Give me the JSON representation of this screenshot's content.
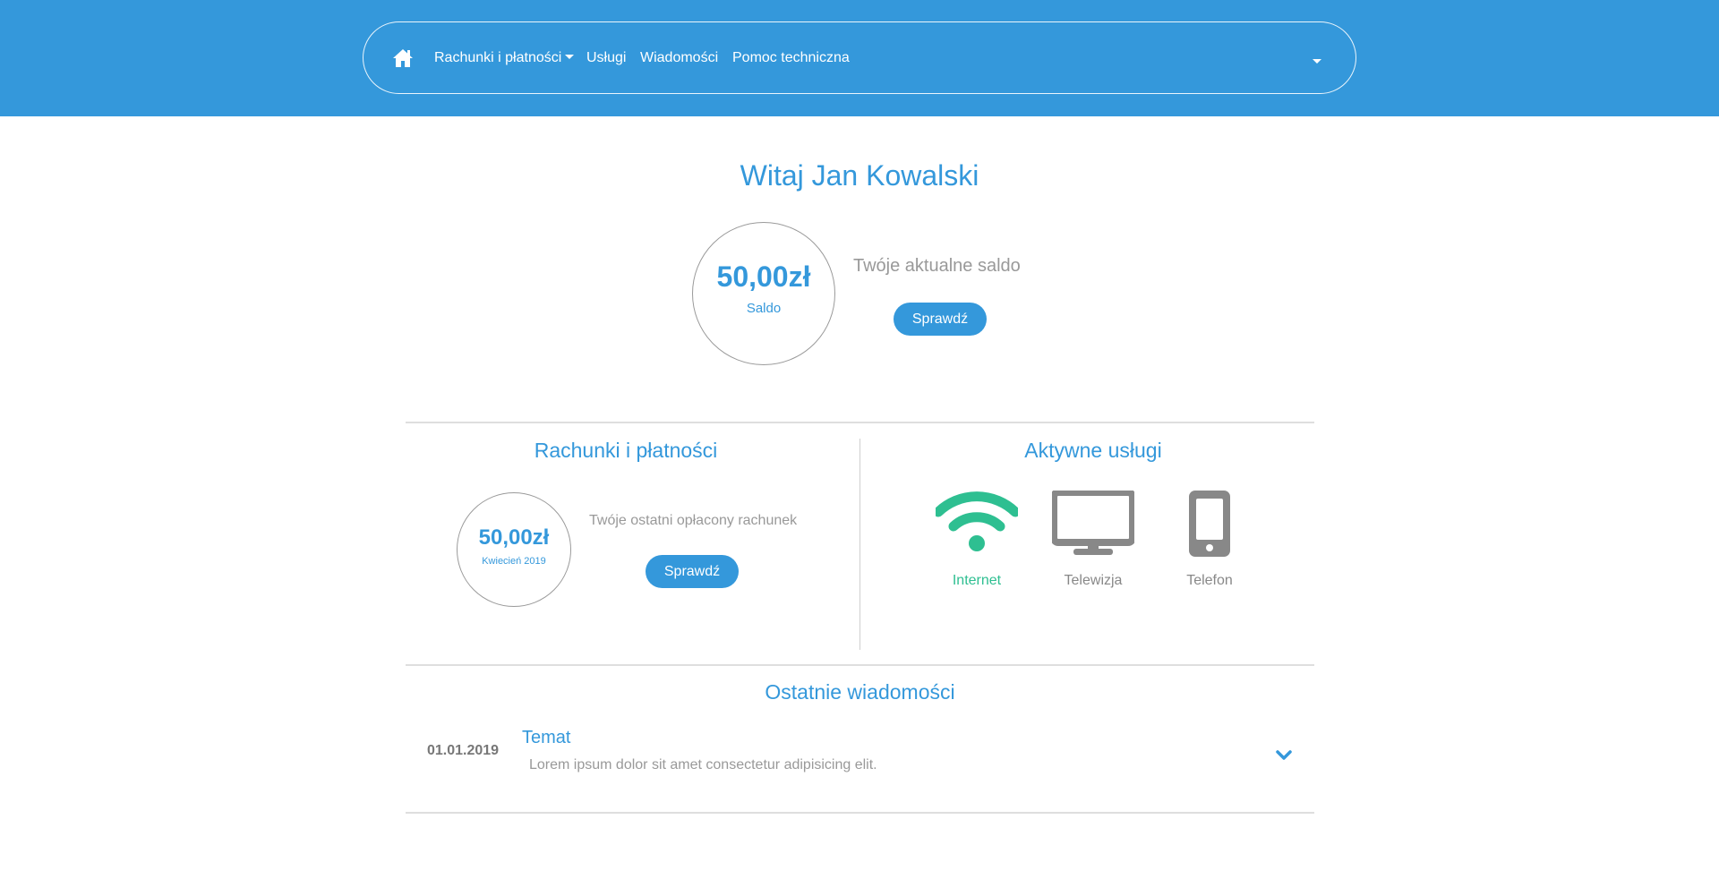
{
  "nav": {
    "home_icon": "home-icon",
    "items": [
      {
        "label": "Rachunki i płatności",
        "dropdown": true
      },
      {
        "label": "Usługi"
      },
      {
        "label": "Wiadomości"
      },
      {
        "label": "Pomoc techniczna"
      }
    ],
    "user_menu_icon": "caret-down-icon"
  },
  "hero": {
    "greeting": "Witaj Jan Kowalski",
    "balance_amount": "50,00zł",
    "balance_label": "Saldo",
    "description": "Twóje aktualne saldo",
    "button_label": "Sprawdź"
  },
  "bills": {
    "title": "Rachunki i płatności",
    "amount": "50,00zł",
    "period": "Kwiecień 2019",
    "description": "Twóje ostatni opłacony rachunek",
    "button_label": "Sprawdź"
  },
  "services": {
    "title": "Aktywne usługi",
    "items": [
      {
        "label": "Internet",
        "icon": "wifi-icon",
        "active": true,
        "color": "#2ebf91"
      },
      {
        "label": "Telewizja",
        "icon": "monitor-icon",
        "active": false,
        "color": "#888888"
      },
      {
        "label": "Telefon",
        "icon": "phone-icon",
        "active": false,
        "color": "#888888"
      }
    ]
  },
  "messages": {
    "title": "Ostatnie wiadomości",
    "items": [
      {
        "date": "01.01.2019",
        "subject": "Temat",
        "body": "Lorem ipsum dolor sit amet consectetur adipisicing elit."
      }
    ]
  },
  "colors": {
    "primary": "#3498db",
    "active_service": "#2ebf91",
    "inactive_service": "#888888",
    "muted_text": "#999999"
  }
}
